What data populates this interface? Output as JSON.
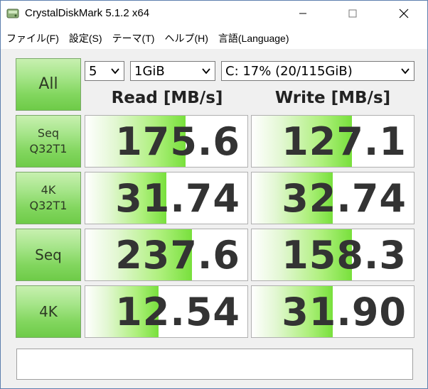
{
  "window": {
    "title": "CrystalDiskMark 5.1.2 x64"
  },
  "menu": [
    {
      "label": "ファイル(F)"
    },
    {
      "label": "設定(S)"
    },
    {
      "label": "テーマ(T)"
    },
    {
      "label": "ヘルプ(H)"
    },
    {
      "label": "言語(Language)"
    }
  ],
  "controls": {
    "all_label": "All",
    "count_value": "5",
    "size_value": "1GiB",
    "drive_value": "C: 17% (20/115GiB)"
  },
  "headers": {
    "read": "Read [MB/s]",
    "write": "Write [MB/s]"
  },
  "tests": [
    {
      "line1": "Seq",
      "line2": "Q32T1",
      "read": "175.6",
      "write": "127.1",
      "read_fill": 0.62,
      "write_fill": 0.62
    },
    {
      "line1": "4K",
      "line2": "Q32T1",
      "read": "31.74",
      "write": "32.74",
      "read_fill": 0.5,
      "write_fill": 0.5
    },
    {
      "line1": "Seq",
      "line2": "",
      "read": "237.6",
      "write": "158.3",
      "read_fill": 0.66,
      "write_fill": 0.62
    },
    {
      "line1": "4K",
      "line2": "",
      "read": "12.54",
      "write": "31.90",
      "read_fill": 0.45,
      "write_fill": 0.5
    }
  ],
  "comment": "",
  "colors": {
    "button_green": "#82d65e",
    "bar_green": "#78e03c",
    "value_text": "#333333",
    "panel_bg": "#f0f0f0"
  }
}
